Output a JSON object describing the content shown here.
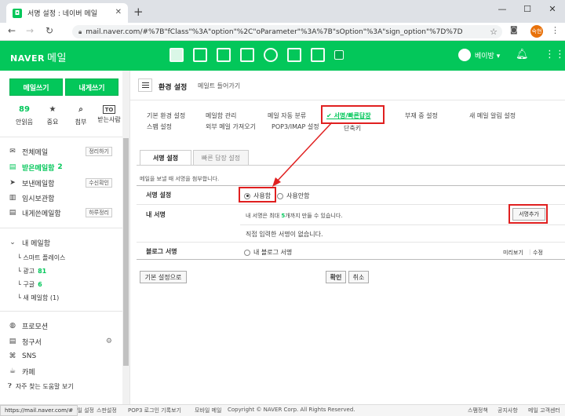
{
  "browser": {
    "tab_title": "서명 설정 : 네이버 메일",
    "url": "mail.naver.com/#%7B\"fClass\"%3A\"option\"%2C\"oParameter\"%3A%7B\"sOption\"%3A\"sign_option\"%7D%7D",
    "profile_label": "숙현"
  },
  "header": {
    "logo": "NAVER",
    "logo_suffix": "메일",
    "username": "베이방 ▾"
  },
  "sidebar": {
    "write_button": "메일쓰기",
    "self_button": "내게쓰기",
    "quick": [
      {
        "top": "89",
        "label": "안읽음"
      },
      {
        "top": "★",
        "label": "중요"
      },
      {
        "top": "⌕",
        "label": "첨부"
      },
      {
        "top": "TO",
        "label": "받는사람"
      }
    ],
    "folders": [
      {
        "icon": "✉",
        "label": "전체메일",
        "tag": "정리하기"
      },
      {
        "icon": "▤",
        "label": "받은메일함",
        "count": "2"
      },
      {
        "icon": "➤",
        "label": "보낸메일함",
        "tag": "수신확인"
      },
      {
        "icon": "▥",
        "label": "임시보관함"
      },
      {
        "icon": "▤",
        "label": "내게쓴메일함",
        "tag": "하루정리"
      }
    ],
    "mybox_title": "내 메일함",
    "mybox": [
      {
        "label": "스마트 플레이스"
      },
      {
        "label": "광고",
        "count": "81"
      },
      {
        "label": "구글",
        "count": "6"
      },
      {
        "label": "새 메일함 (1)"
      }
    ],
    "extras": [
      {
        "icon": "◍",
        "label": "프로모션"
      },
      {
        "icon": "▤",
        "label": "청구서"
      },
      {
        "icon": "⌘",
        "label": "SNS"
      },
      {
        "icon": "☕",
        "label": "카페"
      }
    ],
    "help": "자주 찾는 도움말 보기"
  },
  "main": {
    "title": "환경 설정",
    "import_link": "메일트 들어가기",
    "menu": {
      "basic": "기본 환경 설정",
      "spam": "스팸 설정",
      "mailbox": "메일함 관리",
      "external": "외부 메일 가져오기",
      "autosort": "메일 자동 분류",
      "pop3": "POP3/IMAP 설정",
      "signature": "✔ 서명/빠른답장",
      "shortcut": "단축키",
      "absent": "부재 중 설정",
      "notify": "새 메일 알림 설정"
    },
    "tabs": {
      "sign": "서명 설정",
      "quick": "빠른 답장 설정"
    },
    "description": "메일을 보낼 때 서명을 첨부합니다.",
    "sign_setting_label": "서명 설정",
    "radio_use": "사용함",
    "radio_nouse": "사용안함",
    "my_sign_label": "내 서명",
    "sign_limit_pre": "내 서명은 최대",
    "sign_limit_num": "5",
    "sign_limit_post": "개까지 만들 수 있습니다.",
    "add_sign": "서명추가",
    "no_sign": "직접 입력한 서명이 없습니다.",
    "blog_label": "블로그 서명",
    "blog_radio": "내 블로그 서명",
    "preview": "미리보기",
    "edit": "수정",
    "reset": "기본 설정으로",
    "confirm": "확인",
    "cancel": "취소"
  },
  "status": {
    "url": "https://mail.naver.com/#",
    "footer": [
      "메일 설정",
      "스판설정",
      "POP3 로그인 기록보기",
      "모바일 메일",
      "Copyright © NAVER Corp. All Rights Reserved."
    ],
    "naver_corp": "NAVER Corp.",
    "right": [
      "스팸정책",
      "공지사항",
      "메일 고객센터"
    ]
  },
  "colors": {
    "accent": "#03c75a",
    "highlight": "#e02020"
  }
}
